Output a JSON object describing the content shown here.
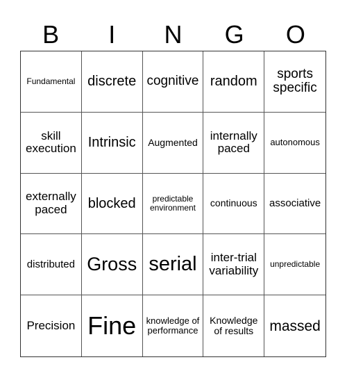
{
  "header": {
    "letters": [
      "B",
      "I",
      "N",
      "G",
      "O"
    ]
  },
  "cells": [
    {
      "text": "Fundamental",
      "size": "s12"
    },
    {
      "text": "discrete",
      "size": "s20"
    },
    {
      "text": "cognitive",
      "size": "s19"
    },
    {
      "text": "random",
      "size": "s20"
    },
    {
      "text": "sports specific",
      "size": "s19"
    },
    {
      "text": "skill execution",
      "size": "s17"
    },
    {
      "text": "Intrinsic",
      "size": "s20"
    },
    {
      "text": "Augmented",
      "size": "s14"
    },
    {
      "text": "internally paced",
      "size": "s17"
    },
    {
      "text": "autonomous",
      "size": "s13"
    },
    {
      "text": "externally paced",
      "size": "s17"
    },
    {
      "text": "blocked",
      "size": "s20"
    },
    {
      "text": "predictable environment",
      "size": "s12"
    },
    {
      "text": "continuous",
      "size": "s14"
    },
    {
      "text": "associative",
      "size": "s15"
    },
    {
      "text": "distributed",
      "size": "s15"
    },
    {
      "text": "Gross",
      "size": "s27"
    },
    {
      "text": "serial",
      "size": "s29"
    },
    {
      "text": "inter-trial variability",
      "size": "s17"
    },
    {
      "text": "unpredictable",
      "size": "s12"
    },
    {
      "text": "Precision",
      "size": "s17"
    },
    {
      "text": "Fine",
      "size": "s36"
    },
    {
      "text": "knowledge of performance",
      "size": "s13"
    },
    {
      "text": "Knowledge of results",
      "size": "s14"
    },
    {
      "text": "massed",
      "size": "s21"
    }
  ]
}
